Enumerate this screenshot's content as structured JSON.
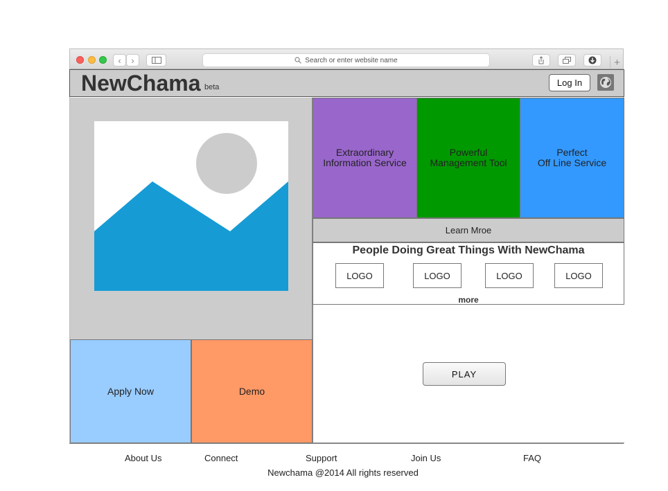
{
  "browser": {
    "address_placeholder": "Search or enter website name",
    "new_tab_glyph": "+",
    "back_glyph": "‹",
    "forward_glyph": "›"
  },
  "header": {
    "logo": "NewChama",
    "beta": "beta",
    "login_label": "Log In"
  },
  "services": [
    {
      "line1": "Extraordinary",
      "line2": "Information Service",
      "color": "#9966CC"
    },
    {
      "line1": "Powerful",
      "line2": "Management Tool",
      "color": "#009900"
    },
    {
      "line1": "Perfect",
      "line2": "Off Line Service",
      "color": "#3399FF"
    }
  ],
  "learn_more": "Learn Mroe",
  "partners": {
    "title": "People Doing Great Things With NewChama",
    "logos": [
      "LOGO",
      "LOGO",
      "LOGO",
      "LOGO"
    ],
    "more": "more"
  },
  "video": {
    "play_label": "PLAY"
  },
  "actions": {
    "apply": {
      "label": "Apply Now",
      "color": "#99CCFF"
    },
    "demo": {
      "label": "Demo",
      "color": "#FF9966"
    }
  },
  "footer": {
    "links": [
      "About Us",
      "Connect",
      "Support",
      "Join Us",
      "FAQ"
    ],
    "copyright": "Newchama @2014 All rights reserved"
  },
  "colors": {
    "panel_gray": "#cccccc",
    "image_blue": "#169BD5"
  }
}
